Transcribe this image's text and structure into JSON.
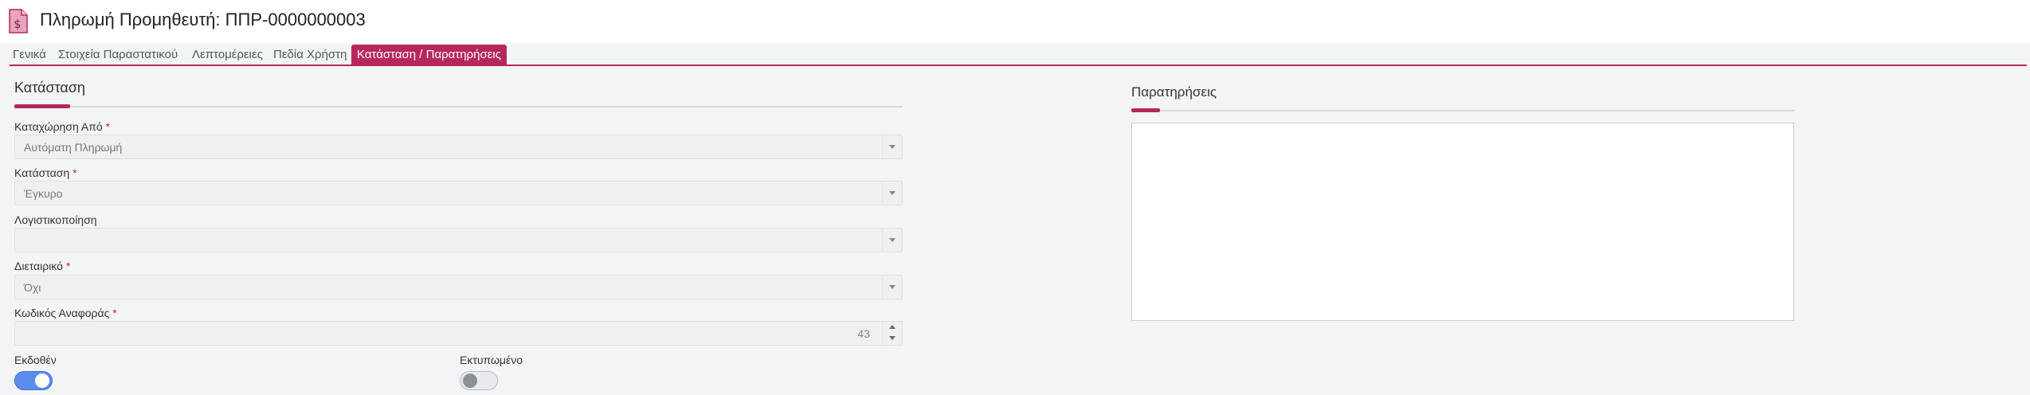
{
  "header": {
    "title": "Πληρωμή Προμηθευτή: ΠΠΡ-0000000003",
    "icon": "invoice-dollar-icon"
  },
  "tabs": [
    {
      "label": "Γενικά"
    },
    {
      "label": "Στοιχεία Παραστατικού"
    },
    {
      "label": "Λεπτομέρειες"
    },
    {
      "label": "Πεδία Χρήστη"
    },
    {
      "label": "Κατάσταση / Παρατηρήσεις",
      "active": true
    }
  ],
  "status_section": {
    "title": "Κατάσταση",
    "fields": {
      "registered_by": {
        "label": "Καταχώρηση Από",
        "value": "Αυτόματη Πληρωμή",
        "required": true
      },
      "status": {
        "label": "Κατάσταση",
        "value": "Έγκυρο",
        "required": true
      },
      "accounting": {
        "label": "Λογιστικοποίηση",
        "value": ""
      },
      "intercompany": {
        "label": "Διεταιρικό",
        "value": "Όχι",
        "required": true
      },
      "reference_code": {
        "label": "Κωδικός Αναφοράς",
        "value": "43",
        "required": true
      }
    },
    "issued": {
      "label": "Εκδοθέν",
      "on": true
    },
    "printed": {
      "label": "Εκτυπωμένο",
      "on": false
    }
  },
  "notes_section": {
    "title": "Παρατηρήσεις",
    "value": ""
  },
  "colors": {
    "accent": "#b7275c",
    "toggle_on": "#5b8def"
  }
}
